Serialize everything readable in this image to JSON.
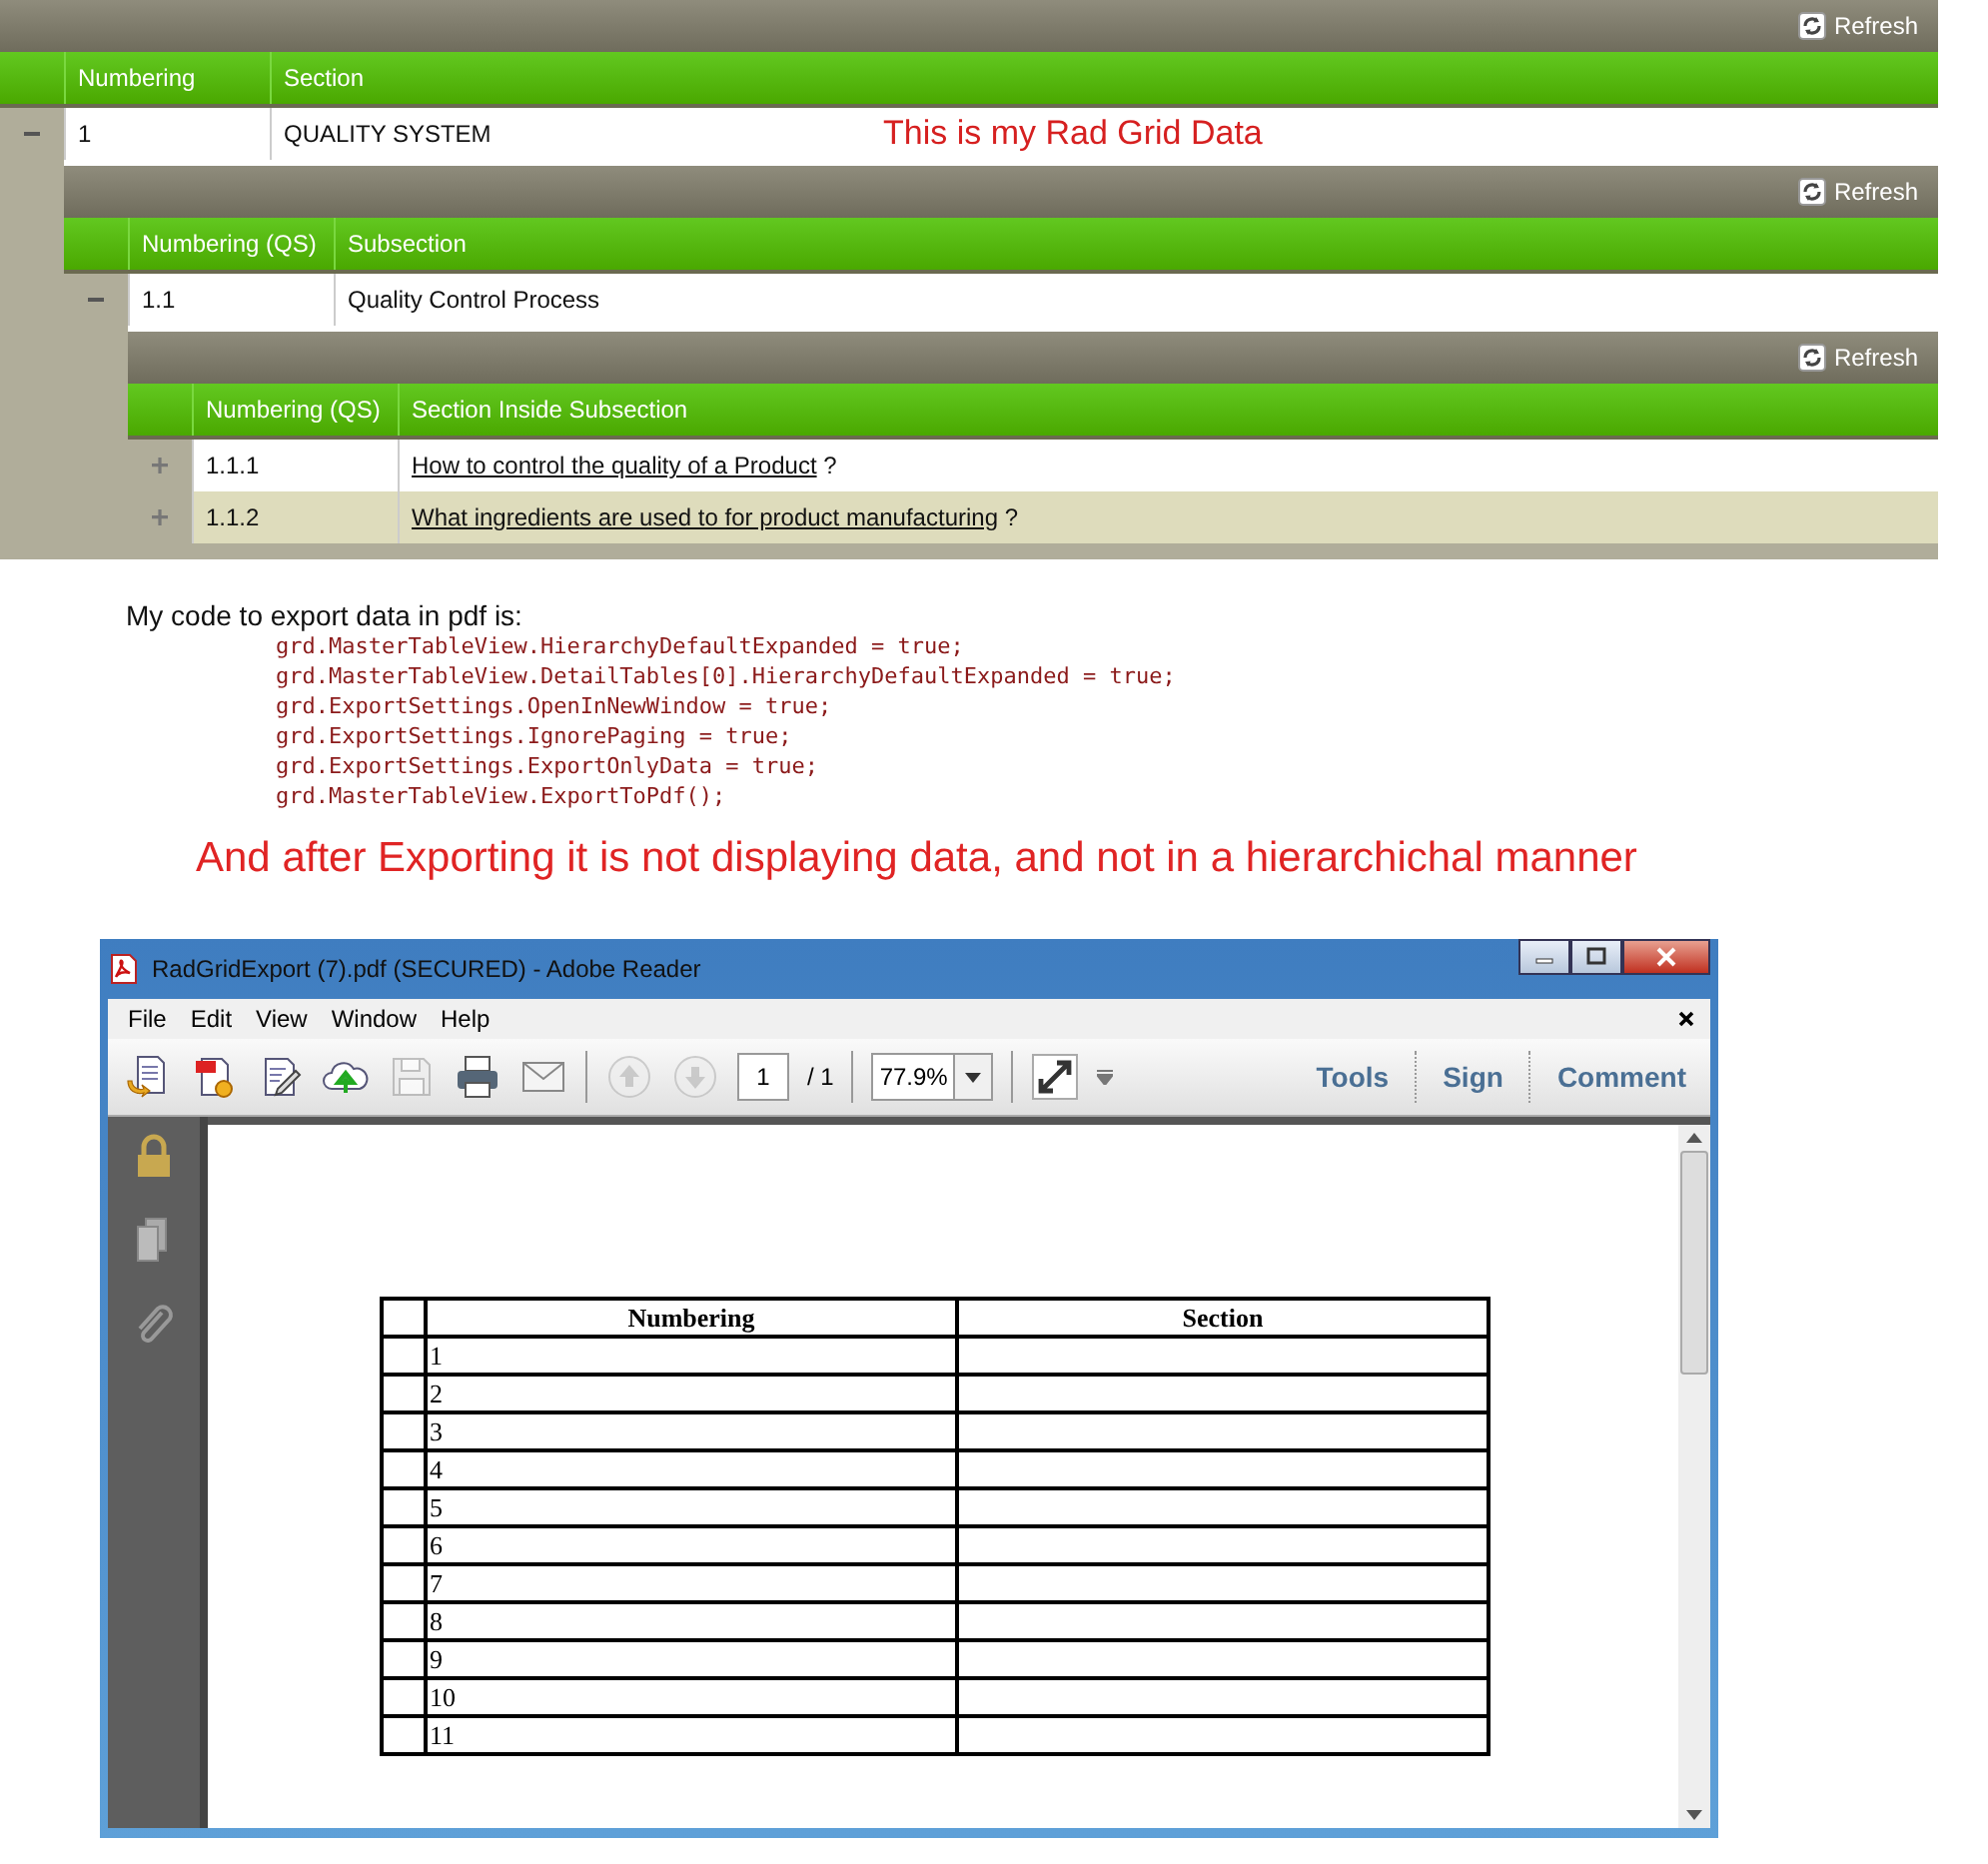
{
  "grid": {
    "refresh": "Refresh",
    "columns": [
      "Numbering",
      "Section"
    ],
    "row": {
      "expanded": true,
      "number": "1",
      "text": "QUALITY SYSTEM"
    },
    "annotation": "This is my Rad Grid Data",
    "detail": {
      "refresh": "Refresh",
      "columns": [
        "Numbering (QS)",
        "Subsection"
      ],
      "row": {
        "expanded": true,
        "number": "1.1",
        "text": "Quality Control Process"
      },
      "detail": {
        "refresh": "Refresh",
        "columns": [
          "Numbering (QS)",
          "Section Inside Subsection"
        ],
        "rows": [
          {
            "expanded": false,
            "number": "1.1.1",
            "link": "How to control the quality of a Product",
            "suffix": " ?"
          },
          {
            "expanded": false,
            "number": "1.1.2",
            "link": "What ingredients are used to for product manufacturing",
            "suffix": " ?"
          }
        ]
      }
    }
  },
  "intro": "My code to export data in pdf is:",
  "code": [
    "grd.MasterTableView.HierarchyDefaultExpanded = true;",
    "grd.MasterTableView.DetailTables[0].HierarchyDefaultExpanded = true;",
    "grd.ExportSettings.OpenInNewWindow = true;",
    "grd.ExportSettings.IgnorePaging = true;",
    "grd.ExportSettings.ExportOnlyData = true;",
    "grd.MasterTableView.ExportToPdf();"
  ],
  "message": "And after Exporting it is not displaying data, and not in a hierarchichal manner",
  "reader": {
    "title": "RadGridExport (7).pdf (SECURED) - Adobe Reader",
    "menu": [
      "File",
      "Edit",
      "View",
      "Window",
      "Help"
    ],
    "page_number": "1",
    "page_total": "/ 1",
    "zoom": "77.9%",
    "panels": [
      "Tools",
      "Sign",
      "Comment"
    ],
    "table": {
      "columns": [
        "Numbering",
        "Section"
      ],
      "rows": [
        "1",
        "2",
        "3",
        "4",
        "5",
        "6",
        "7",
        "8",
        "9",
        "10",
        "11"
      ]
    }
  }
}
